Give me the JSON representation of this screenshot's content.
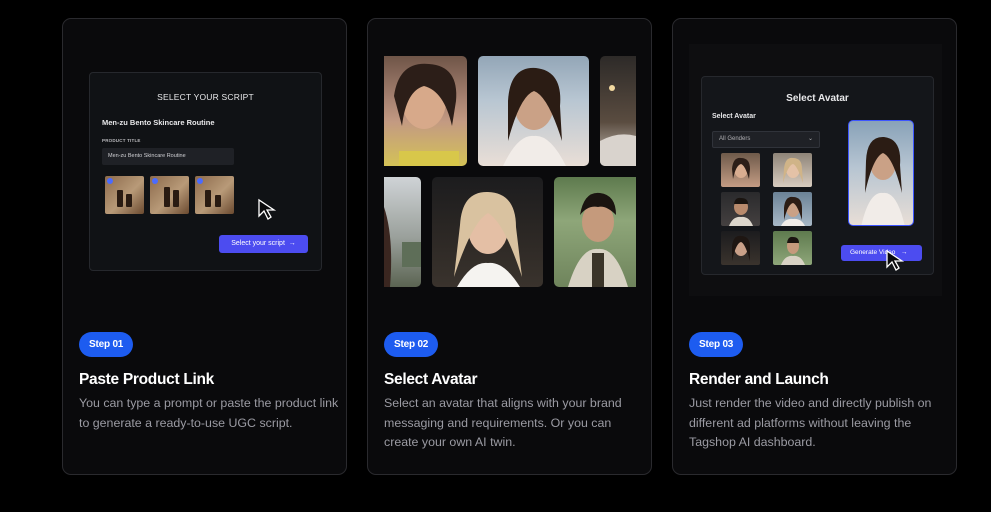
{
  "cards": [
    {
      "step": "Step 01",
      "title": "Paste Product Link",
      "description": "You can type a prompt or paste the product link to generate a ready-to-use UGC script.",
      "preview": {
        "heading": "SELECT YOUR SCRIPT",
        "product_name": "Men-zu Bento Skincare Routine",
        "field_label": "PRODUCT TITLE",
        "field_value": "Men-zu Bento Skincare Routine",
        "button_label": "Select your script",
        "button_arrow": "→"
      }
    },
    {
      "step": "Step 02",
      "title": "Select Avatar",
      "description": "Select an avatar that aligns with your brand messaging and requirements. Or you can create your own AI twin."
    },
    {
      "step": "Step 03",
      "title": "Render and Launch",
      "description": "Just render the video and directly publish on different ad platforms without leaving the Tagshop AI dashboard.",
      "preview": {
        "heading": "Select Avatar",
        "sub_heading": "Select Avatar",
        "select_value": "All Genders",
        "select_icon": "chevron-down-icon",
        "button_label": "Generate Video",
        "button_arrow": "→"
      }
    }
  ],
  "colors": {
    "accent_blue": "#1d5cf0",
    "button_purple": "#4c4cf0",
    "card_bg": "#0a0a0c",
    "page_bg": "#000000"
  }
}
